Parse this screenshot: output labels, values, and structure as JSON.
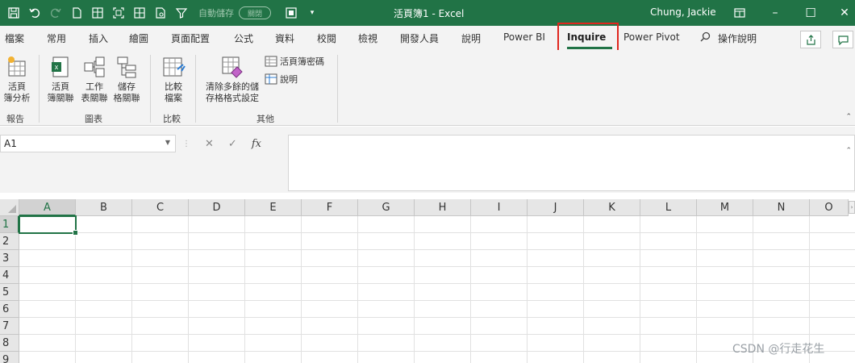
{
  "titlebar": {
    "doc_title": "活頁簿1 - Excel",
    "user": "Chung, Jackie",
    "autosave_label": "自動儲存",
    "autosave_toggle": "關閉",
    "minimize": "–",
    "maximize": "☐",
    "close": "✕",
    "bg_color": "#217346"
  },
  "tabs": [
    {
      "label": "檔案"
    },
    {
      "label": "常用"
    },
    {
      "label": "插入"
    },
    {
      "label": "繪圖"
    },
    {
      "label": "頁面配置"
    },
    {
      "label": "公式"
    },
    {
      "label": "資料"
    },
    {
      "label": "校閱"
    },
    {
      "label": "檢視"
    },
    {
      "label": "開發人員"
    },
    {
      "label": "說明"
    },
    {
      "label": "Power BI"
    },
    {
      "label": "Inquire"
    },
    {
      "label": "Power Pivot"
    },
    {
      "label": "操作說明"
    }
  ],
  "active_tab": "Inquire",
  "ribbon": {
    "workbook_analysis": "活頁\n簿分析",
    "workbook_relationship": "活頁\n簿關聯",
    "worksheet_relationship": "工作\n表關聯",
    "cell_relationship": "儲存\n格關聯",
    "compare_files": "比較\n檔案",
    "clean_formatting": "清除多餘的儲\n存格格式設定",
    "workbook_passwords": "活頁簿密碼",
    "help": "說明",
    "group_report": "報告",
    "group_diagram": "圖表",
    "group_compare": "比較",
    "group_misc": "其他"
  },
  "formula_bar": {
    "name_box": "A1",
    "fx": "fx",
    "cancel": "✕",
    "enter": "✓",
    "formula": ""
  },
  "grid": {
    "columns": [
      "A",
      "B",
      "C",
      "D",
      "E",
      "F",
      "G",
      "H",
      "I",
      "J",
      "K",
      "L",
      "M",
      "N",
      "O"
    ],
    "rows": [
      "1",
      "2",
      "3",
      "4",
      "5",
      "6",
      "7",
      "8",
      "9"
    ],
    "selected_cell": "A1"
  },
  "watermark": "CSDN @行走花生"
}
